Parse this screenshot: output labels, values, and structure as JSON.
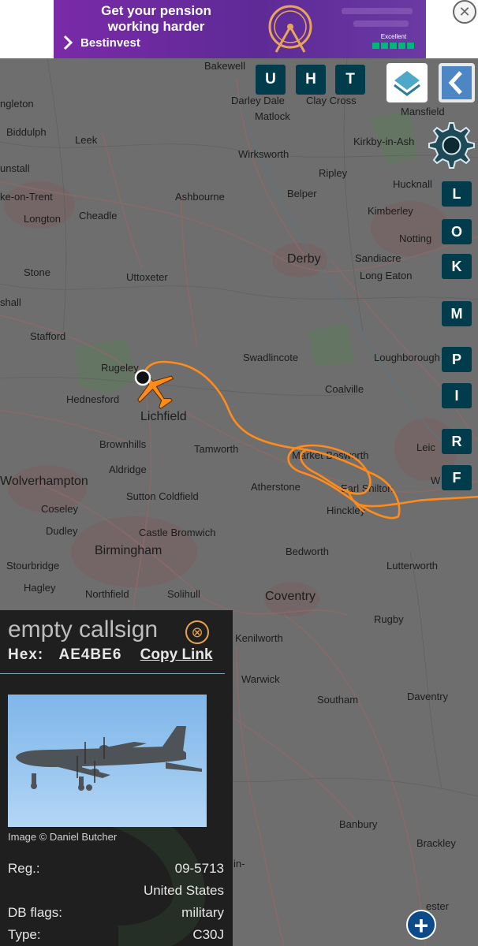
{
  "ad": {
    "headline": "Get your pension working harder",
    "brand": "Bestinvest",
    "rating": "Excellent",
    "close_glyph": "✕",
    "ad_x": "✕"
  },
  "map_buttons": {
    "top": [
      "U",
      "H",
      "T"
    ],
    "side": [
      "L",
      "O",
      "K",
      "M",
      "P",
      "I",
      "R",
      "F"
    ]
  },
  "places": [
    {
      "name": "Bakewell"
    },
    {
      "name": "Darley Dale"
    },
    {
      "name": "Clay Cross"
    },
    {
      "name": "Matlock"
    },
    {
      "name": "Mansfield"
    },
    {
      "name": "ngleton"
    },
    {
      "name": "Biddulph"
    },
    {
      "name": "Leek"
    },
    {
      "name": "Wirksworth"
    },
    {
      "name": "Kirkby-in-Ash"
    },
    {
      "name": "unstall"
    },
    {
      "name": "Ripley"
    },
    {
      "name": "Hucknall"
    },
    {
      "name": "ke-on-Trent"
    },
    {
      "name": "Ashbourne"
    },
    {
      "name": "Belper"
    },
    {
      "name": "Longton"
    },
    {
      "name": "Cheadle"
    },
    {
      "name": "Kimberley"
    },
    {
      "name": "Notting"
    },
    {
      "name": "Derby"
    },
    {
      "name": "Sandiacre"
    },
    {
      "name": "Stone"
    },
    {
      "name": "Uttoxeter"
    },
    {
      "name": "Long Eaton"
    },
    {
      "name": "shall"
    },
    {
      "name": "Stafford"
    },
    {
      "name": "Swadlincote"
    },
    {
      "name": "Loughborough"
    },
    {
      "name": "Rugeley"
    },
    {
      "name": "Hednesford"
    },
    {
      "name": "Lichfield"
    },
    {
      "name": "Coalville"
    },
    {
      "name": "Brownhills"
    },
    {
      "name": "Tamworth"
    },
    {
      "name": "Market Bosworth"
    },
    {
      "name": "Leic"
    },
    {
      "name": "Aldridge"
    },
    {
      "name": "Wolverhampton"
    },
    {
      "name": "Atherstone"
    },
    {
      "name": "Earl Shilton"
    },
    {
      "name": "W"
    },
    {
      "name": "Sutton Coldfield"
    },
    {
      "name": "Coseley"
    },
    {
      "name": "Hinckley"
    },
    {
      "name": "Dudley"
    },
    {
      "name": "Castle Bromwich"
    },
    {
      "name": "Birmingham"
    },
    {
      "name": "Bedworth"
    },
    {
      "name": "Stourbridge"
    },
    {
      "name": "Lutterworth"
    },
    {
      "name": "Hagley"
    },
    {
      "name": "Northfield"
    },
    {
      "name": "Solihull"
    },
    {
      "name": "Coventry"
    },
    {
      "name": "Rugby"
    },
    {
      "name": "Kenilworth"
    },
    {
      "name": "Warwick"
    },
    {
      "name": "Southam"
    },
    {
      "name": "Daventry"
    },
    {
      "name": "Banbury"
    },
    {
      "name": "Brackley"
    },
    {
      "name": "in-"
    },
    {
      "name": "ester"
    }
  ],
  "panel": {
    "callsign": "empty callsign",
    "close_glyph": "⊗",
    "hex_label": "Hex:",
    "hex_value": "AE4BE6",
    "copy_link": "Copy Link",
    "photo_credit": "Image © Daniel Butcher",
    "rows": [
      {
        "label": "Reg.:",
        "value": "09-5713"
      },
      {
        "label": "",
        "value": "United States"
      },
      {
        "label": "DB flags:",
        "value": "military"
      },
      {
        "label": "Type:",
        "value": "C30J"
      }
    ]
  },
  "plus_glyph": "+",
  "colors": {
    "track": "#ff8c1a",
    "button_bg": "#003c4c",
    "panel_bg": "#1f1f1f",
    "accent": "#e8a44a"
  }
}
